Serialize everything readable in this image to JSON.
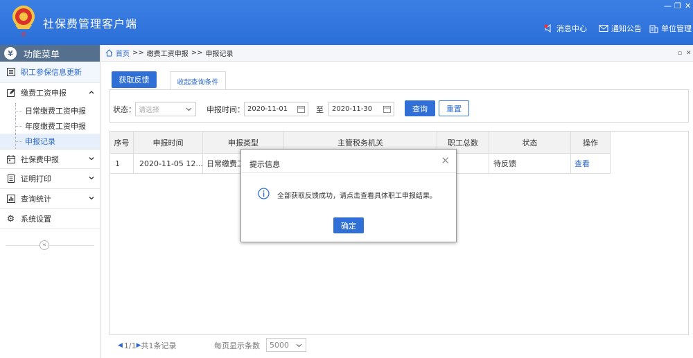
{
  "app": {
    "title": "社保费管理客户端"
  },
  "window_controls": {
    "minimize": "—",
    "restore": "❐",
    "close": "✕"
  },
  "topnav": [
    {
      "label": "消息中心",
      "icon": "speaker-icon"
    },
    {
      "label": "通知公告",
      "icon": "mail-icon"
    },
    {
      "label": "单位管理",
      "icon": "building-icon"
    }
  ],
  "sidebar": {
    "header": "功能菜单",
    "header_icon": "¥",
    "items": [
      {
        "label": "职工参保信息更新",
        "icon": "list-icon"
      },
      {
        "label": "缴费工资申报",
        "icon": "edit-icon"
      },
      {
        "label": "社保费申报",
        "icon": "calendar-icon"
      },
      {
        "label": "证明打印",
        "icon": "document-icon"
      },
      {
        "label": "查询统计",
        "icon": "bar-chart-icon"
      },
      {
        "label": "系统设置",
        "icon": "gear-icon"
      }
    ],
    "subitems": [
      "日常缴费工资申报",
      "年度缴费工资申报",
      "申报记录"
    ],
    "collapse_label": "«"
  },
  "breadcrumb": {
    "home": "首页",
    "sep": ">>",
    "level1": "缴费工资申报",
    "level2": "申报记录",
    "controls": [
      "▫",
      "✕"
    ]
  },
  "toolbar": {
    "feedback_button": "获取反馈",
    "tab_label": "收起查询条件"
  },
  "filter": {
    "status_label": "状态：",
    "status_placeholder": "请选择",
    "date_label": "申报时间：",
    "date_from": "2020-11-01",
    "date_to_label": "至",
    "date_to": "2020-11-30",
    "query_button": "查询",
    "reset_button": "重置"
  },
  "table": {
    "columns": [
      "序号",
      "申报时间",
      "申报类型",
      "主管税务机关",
      "职工总数",
      "状态",
      "操作"
    ],
    "rows": [
      {
        "index": "1",
        "time": "2020-11-05 12...",
        "type": "日常缴费工",
        "authority": "",
        "total": "",
        "status": "待反馈",
        "action": "查看"
      }
    ]
  },
  "pager": {
    "info": "1/1",
    "total": "共1条记录",
    "per_page_label": "每页显示条数",
    "per_page": "5000"
  },
  "dialog": {
    "title": "提示信息",
    "close": "✕",
    "message": "全部获取反馈成功，请点击查看具体职工申报结果。",
    "ok_button": "确定"
  },
  "colors": {
    "primary": "#2f6fd6",
    "sidebar_header": "#55708f",
    "link": "#2d6ad1"
  }
}
